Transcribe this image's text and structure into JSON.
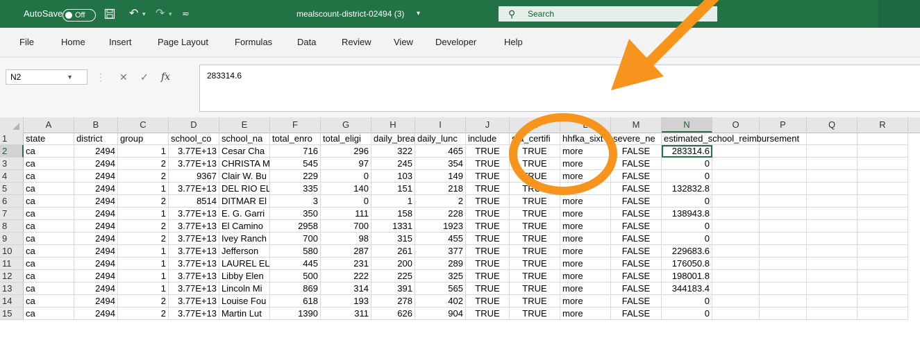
{
  "titlebar": {
    "autosave_label": "AutoSave",
    "autosave_state": "Off",
    "filename": "mealscount-district-02494 (3)",
    "filename_chevron": "▾",
    "search_placeholder": "Search",
    "icons": [
      "save-icon",
      "undo-icon",
      "redo-icon",
      "customize-icon",
      "search-icon"
    ],
    "accent": "#217346"
  },
  "menu": [
    "File",
    "Home",
    "Insert",
    "Page Layout",
    "Formulas",
    "Data",
    "Review",
    "View",
    "Developer",
    "Help"
  ],
  "formula_bar": {
    "name_box": "N2",
    "formula": "283314.6",
    "fx": "fx"
  },
  "columns": [
    "A",
    "B",
    "C",
    "D",
    "E",
    "F",
    "G",
    "H",
    "I",
    "J",
    "K",
    "L",
    "M",
    "N",
    "O",
    "P",
    "Q",
    "R"
  ],
  "header_row": [
    "state",
    "district",
    "group",
    "school_co",
    "school_na",
    "total_enro",
    "total_eligi",
    "daily_brea",
    "daily_lunc",
    "include",
    "sfa_certifi",
    "hhfka_sixt",
    "severe_ne",
    "estimated_school_reimbursement",
    "",
    "",
    "",
    ""
  ],
  "rows": [
    {
      "n": "1"
    },
    {
      "n": "2",
      "cells": [
        "ca",
        "2494",
        "1",
        "3.77E+13",
        "Cesar Cha",
        "716",
        "296",
        "322",
        "465",
        "TRUE",
        "TRUE",
        "more",
        "FALSE",
        "283314.6"
      ]
    },
    {
      "n": "3",
      "cells": [
        "ca",
        "2494",
        "2",
        "3.77E+13",
        "CHRISTA M",
        "545",
        "97",
        "245",
        "354",
        "TRUE",
        "TRUE",
        "more",
        "FALSE",
        "0"
      ]
    },
    {
      "n": "4",
      "cells": [
        "ca",
        "2494",
        "2",
        "9367",
        "Clair W. Bu",
        "229",
        "0",
        "103",
        "149",
        "TRUE",
        "TRUE",
        "more",
        "FALSE",
        "0"
      ]
    },
    {
      "n": "5",
      "cells": [
        "ca",
        "2494",
        "1",
        "3.77E+13",
        "DEL RIO EL",
        "335",
        "140",
        "151",
        "218",
        "TRUE",
        "TRUE",
        "more",
        "FALSE",
        "132832.8"
      ]
    },
    {
      "n": "6",
      "cells": [
        "ca",
        "2494",
        "2",
        "8514",
        "DITMAR El",
        "3",
        "0",
        "1",
        "2",
        "TRUE",
        "TRUE",
        "more",
        "FALSE",
        "0"
      ]
    },
    {
      "n": "7",
      "cells": [
        "ca",
        "2494",
        "1",
        "3.77E+13",
        "E. G. Garri",
        "350",
        "111",
        "158",
        "228",
        "TRUE",
        "TRUE",
        "more",
        "FALSE",
        "138943.8"
      ]
    },
    {
      "n": "8",
      "cells": [
        "ca",
        "2494",
        "2",
        "3.77E+13",
        "El Camino",
        "2958",
        "700",
        "1331",
        "1923",
        "TRUE",
        "TRUE",
        "more",
        "FALSE",
        "0"
      ]
    },
    {
      "n": "9",
      "cells": [
        "ca",
        "2494",
        "2",
        "3.77E+13",
        "Ivey Ranch",
        "700",
        "98",
        "315",
        "455",
        "TRUE",
        "TRUE",
        "more",
        "FALSE",
        "0"
      ]
    },
    {
      "n": "10",
      "cells": [
        "ca",
        "2494",
        "1",
        "3.77E+13",
        "Jefferson",
        "580",
        "287",
        "261",
        "377",
        "TRUE",
        "TRUE",
        "more",
        "FALSE",
        "229683.6"
      ]
    },
    {
      "n": "11",
      "cells": [
        "ca",
        "2494",
        "1",
        "3.77E+13",
        "LAUREL EL",
        "445",
        "231",
        "200",
        "289",
        "TRUE",
        "TRUE",
        "more",
        "FALSE",
        "176050.8"
      ]
    },
    {
      "n": "12",
      "cells": [
        "ca",
        "2494",
        "1",
        "3.77E+13",
        "Libby Elen",
        "500",
        "222",
        "225",
        "325",
        "TRUE",
        "TRUE",
        "more",
        "FALSE",
        "198001.8"
      ]
    },
    {
      "n": "13",
      "cells": [
        "ca",
        "2494",
        "1",
        "3.77E+13",
        "Lincoln Mi",
        "869",
        "314",
        "391",
        "565",
        "TRUE",
        "TRUE",
        "more",
        "FALSE",
        "344183.4"
      ]
    },
    {
      "n": "14",
      "cells": [
        "ca",
        "2494",
        "2",
        "3.77E+13",
        "Louise Fou",
        "618",
        "193",
        "278",
        "402",
        "TRUE",
        "TRUE",
        "more",
        "FALSE",
        "0"
      ]
    },
    {
      "n": "15",
      "cells": [
        "ca",
        "2494",
        "2",
        "3.77E+13",
        "Martin Lut",
        "1390",
        "311",
        "626",
        "904",
        "TRUE",
        "TRUE",
        "more",
        "FALSE",
        "0"
      ]
    }
  ],
  "annotation": {
    "color": "#f7941d",
    "arrow": "arrow-annotation",
    "highlight": "circle-annotation"
  }
}
